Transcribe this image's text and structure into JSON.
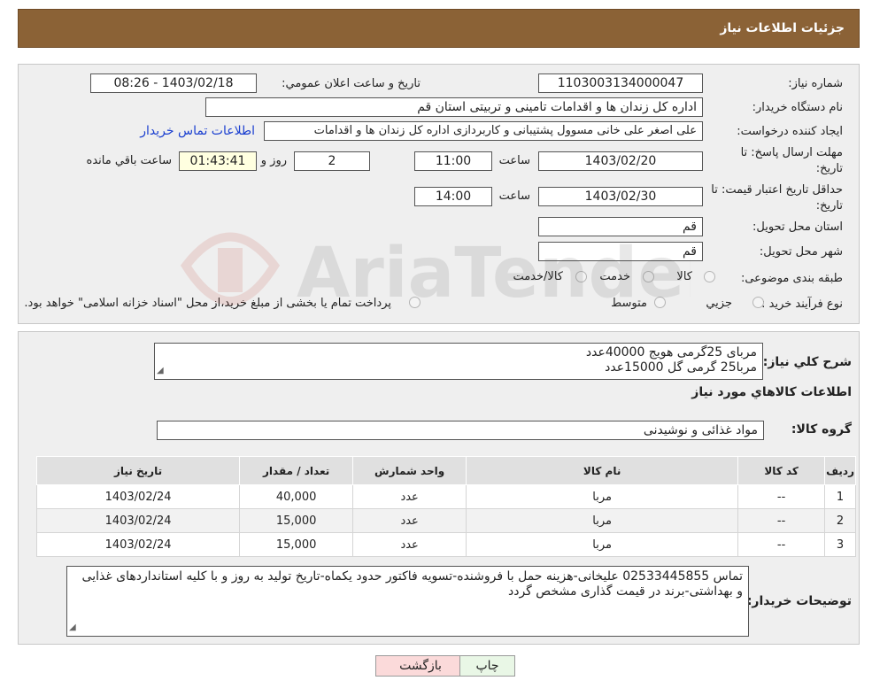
{
  "header": {
    "title": "جزئیات اطلاعات نیاز"
  },
  "form": {
    "need_number_label": "شماره نیاز:",
    "need_number": "1103003134000047",
    "announce_label": "تاریخ و ساعت اعلان عمومي:",
    "announce_value": "1403/02/18 - 08:26",
    "buyer_org_label": "نام دستگاه خريدار:",
    "buyer_org": "اداره کل زندان ها و اقدامات تامینی و تربیتی استان قم",
    "creator_label": "ايجاد کننده درخواست:",
    "creator": "علی اصغر علی خانی مسوول پشتیبانی و کاربردازی اداره کل زندان ها و اقدامات",
    "contact_link": "اطلاعات تماس خريدار",
    "deadline_label_1": "مهلت ارسال پاسخ: تا",
    "deadline_label_2": "تاریخ:",
    "deadline_date": "1403/02/20",
    "time_label": "ساعت",
    "deadline_time": "11:00",
    "days": "2",
    "days_label": "روز و",
    "remaining": "01:43:41",
    "remaining_label": "ساعت باقي مانده",
    "price_validity_label_1": "حداقل تاريخ اعتبار قيمت: تا",
    "price_validity_label_2": "تاريخ:",
    "price_validity_date": "1403/02/30",
    "price_validity_time": "14:00",
    "province_label": "استان محل تحويل:",
    "province": "قم",
    "city_label": "شهر محل تحويل:",
    "city": "قم",
    "category_label": "طبقه بندی موضوعی:",
    "category_options": [
      "کالا",
      "خدمت",
      "کالا/خدمت"
    ],
    "process_label": "نوع فرآيند خريد :",
    "process_options": [
      "جزيي",
      "متوسط"
    ],
    "process_note": "پرداخت تمام يا بخشی از مبلغ خريد،از محل \"اسناد خزانه اسلامی\" خواهد بود."
  },
  "details": {
    "summary_label": "شرح كلي نياز:",
    "summary_lines": [
      "مربای 25گرمی هویج 40000عدد",
      "مربا25 گرمی گل 15000عدد"
    ],
    "goods_info_title": "اطلاعات كالاهاي مورد نياز",
    "group_label": "گروه كالا:",
    "group_value": "مواد غذائی و نوشیدنی",
    "table_headers": [
      "رديف",
      "كد كالا",
      "نام كالا",
      "واحد شمارش",
      "تعداد / مقدار",
      "تاريخ نياز"
    ],
    "rows": [
      [
        "1",
        "--",
        "مربا",
        "عدد",
        "40,000",
        "1403/02/24"
      ],
      [
        "2",
        "--",
        "مربا",
        "عدد",
        "15,000",
        "1403/02/24"
      ],
      [
        "3",
        "--",
        "مربا",
        "عدد",
        "15,000",
        "1403/02/24"
      ]
    ],
    "buyer_notes_label": "توضيحات خريدار:",
    "buyer_notes": "تماس 02533445855 علیخانی-هزینه حمل با فروشنده-تسویه فاکتور حدود یکماه-تاریخ تولید به روز و با کلیه استانداردهای غذایی و بهداشتی-برند در قیمت گذاری مشخص گردد"
  },
  "buttons": {
    "print": "چاپ",
    "back": "بازگشت"
  },
  "colors": {
    "header_bg": "#8b6236",
    "link": "#1a3fd0",
    "back_btn": "#fbdada",
    "print_btn": "#e9f7e6"
  }
}
